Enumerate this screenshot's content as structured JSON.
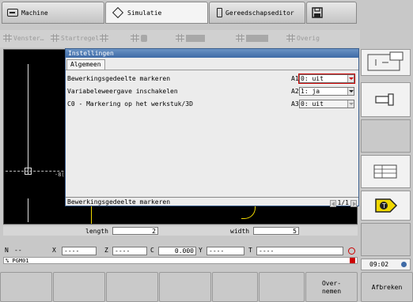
{
  "top_tabs": [
    {
      "label": "Machine"
    },
    {
      "label": "Simulatie"
    },
    {
      "label": "Gereedschapseditor"
    }
  ],
  "toolbar": {
    "venster_label": "Venster…",
    "startregel_label": "Startregel",
    "overig_label": "Overig"
  },
  "dialog": {
    "title": "Instellingen",
    "tab": "Algemeen",
    "rows": [
      {
        "label": "Bewerkingsgedeelte markeren",
        "code": "A1",
        "value": "0: uit"
      },
      {
        "label": "Variabeleweergave inschakelen",
        "code": "A2",
        "value": "1: ja"
      },
      {
        "label": "C0 - Markering op het werkstuk/3D",
        "code": "A3",
        "value": "0: uit"
      }
    ],
    "status_text": "Bewerkingsgedeelte markeren",
    "page": "1/1"
  },
  "graphics": {
    "fragment_text": "-8("
  },
  "info": {
    "length_label": "length",
    "length_value": "2",
    "width_label": "width",
    "width_value": "5"
  },
  "coords": {
    "n_label": "N",
    "n_value": "--",
    "x_label": "X",
    "x_value": "----",
    "z_label": "Z",
    "z_value": "----",
    "c_label": "C",
    "c_value": "0.000",
    "y_label": "Y",
    "y_value": "----",
    "t_label": "T",
    "t_value": "----"
  },
  "program": {
    "name": "% PGM01"
  },
  "clock": "09:02",
  "softkeys": {
    "overnemen": "Over-\nnemen",
    "afbreken": "Afbreken"
  },
  "colors": {
    "title_bar": "#3e6aa6",
    "graphics_bg": "#000000",
    "accent_red": "#c00000",
    "tool_yellow": "#f0d800"
  }
}
